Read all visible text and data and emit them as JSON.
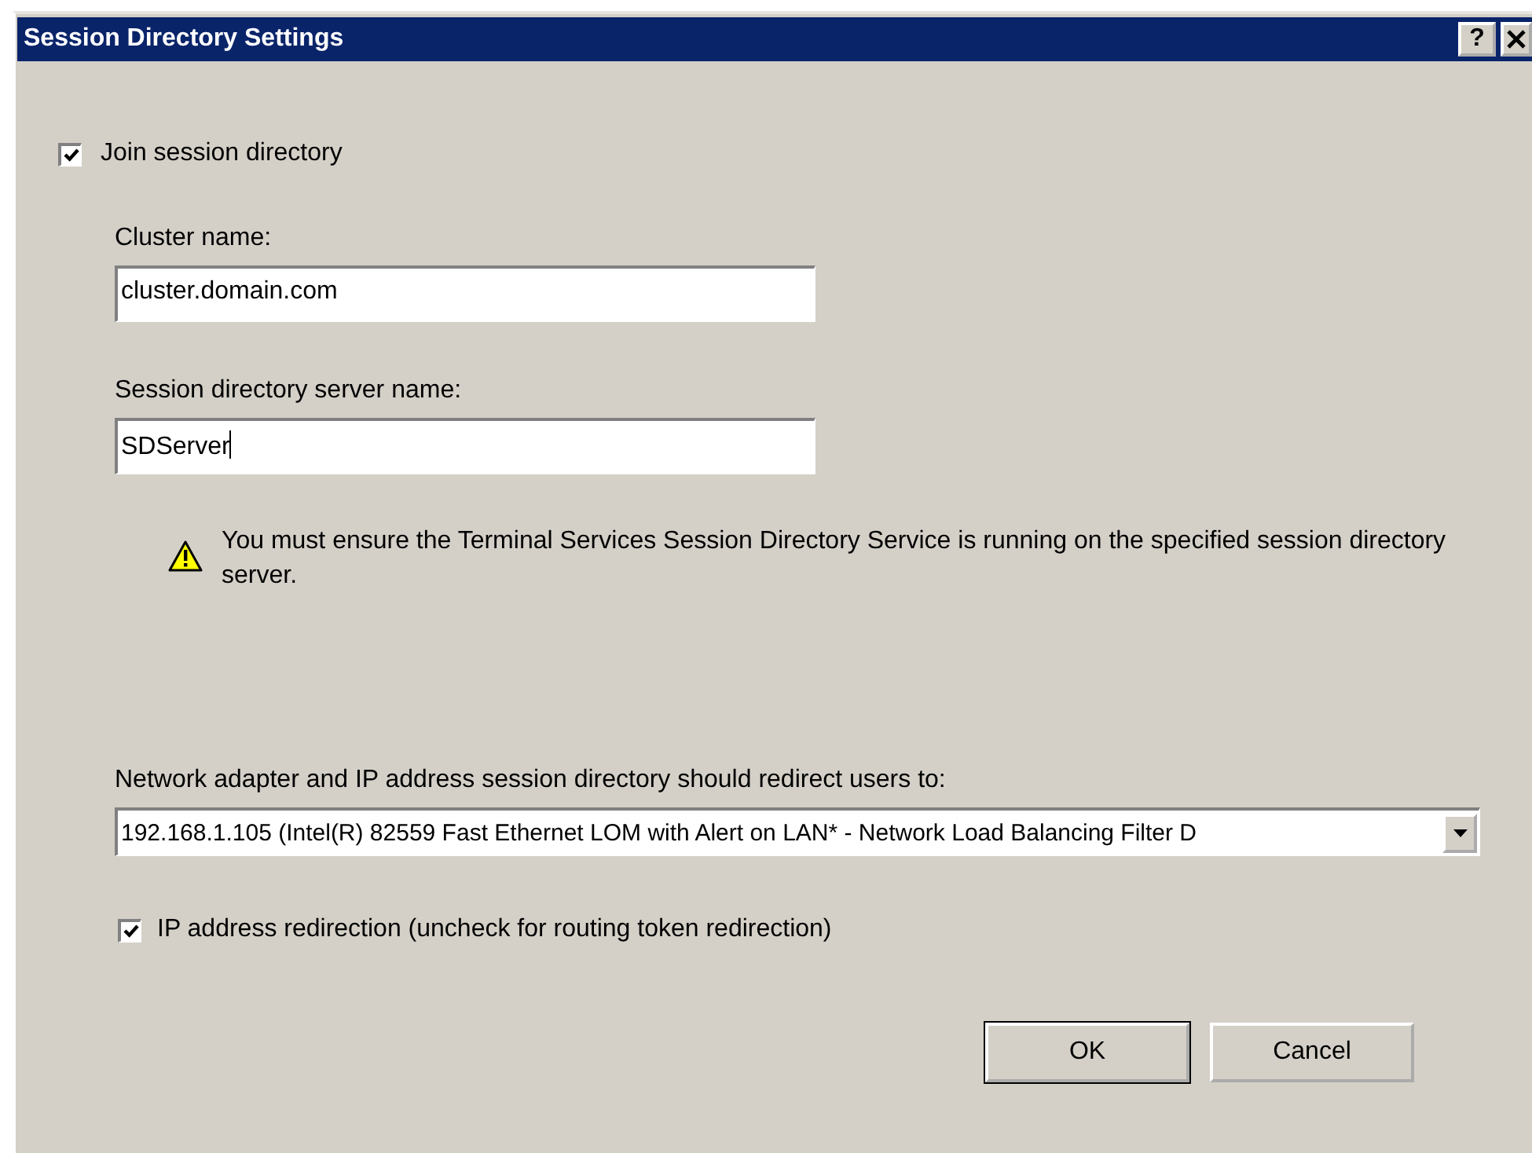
{
  "window": {
    "title": "Session Directory Settings",
    "help_button": "?"
  },
  "join": {
    "label": "Join session directory",
    "checked": true
  },
  "cluster": {
    "label": "Cluster name:",
    "value": "cluster.domain.com"
  },
  "server": {
    "label": "Session directory server name:",
    "value": "SDServer",
    "focused": true
  },
  "warning": "You must ensure the Terminal Services Session Directory Service is running on the specified session directory server.",
  "adapter": {
    "label": "Network adapter and IP address session directory should redirect users to:",
    "value": "192.168.1.105 (Intel(R) 82559 Fast Ethernet LOM with Alert on LAN* - Network Load Balancing Filter D"
  },
  "ip_redirect": {
    "label": "IP address redirection (uncheck for routing token redirection)",
    "checked": true
  },
  "buttons": [
    "OK",
    "Cancel"
  ]
}
